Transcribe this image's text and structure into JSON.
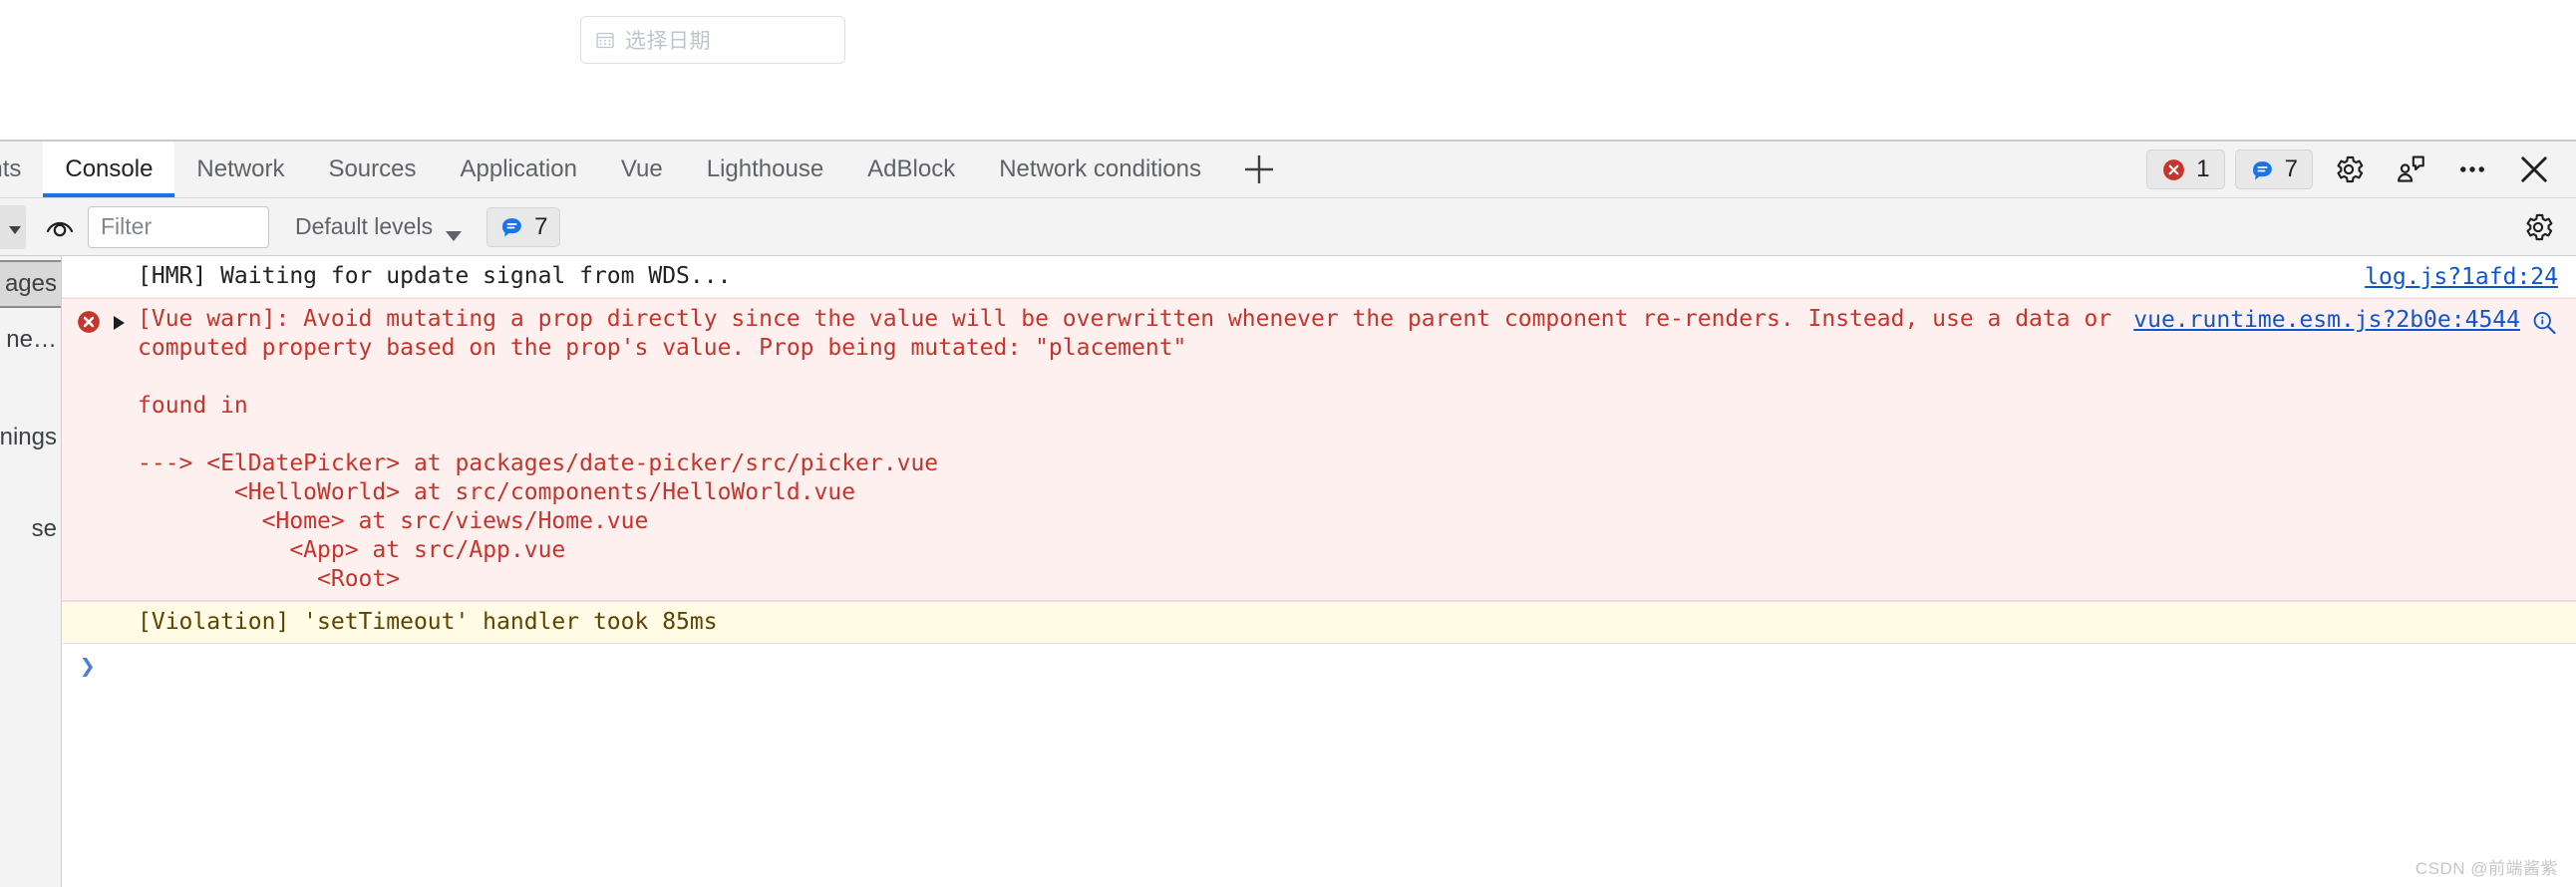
{
  "page": {
    "datepicker": {
      "placeholder": "选择日期",
      "icon": "calendar-icon",
      "value": ""
    }
  },
  "devtools": {
    "tabs": [
      {
        "label": "ments",
        "active": false,
        "clipped": true
      },
      {
        "label": "Console",
        "active": true,
        "clipped": false
      },
      {
        "label": "Network",
        "active": false,
        "clipped": false
      },
      {
        "label": "Sources",
        "active": false,
        "clipped": false
      },
      {
        "label": "Application",
        "active": false,
        "clipped": false
      },
      {
        "label": "Vue",
        "active": false,
        "clipped": false
      },
      {
        "label": "Lighthouse",
        "active": false,
        "clipped": false
      },
      {
        "label": "AdBlock",
        "active": false,
        "clipped": false
      },
      {
        "label": "Network conditions",
        "active": false,
        "clipped": false
      }
    ],
    "add_tab_label": "+",
    "status": {
      "error_count": "1",
      "info_count": "7",
      "error_color": "#c5352b",
      "info_color": "#1a73e8"
    },
    "toolbar_icons": [
      {
        "name": "settings-gear-icon"
      },
      {
        "name": "feedback-icon"
      },
      {
        "name": "more-options-icon"
      },
      {
        "name": "close-devtools-icon"
      }
    ],
    "filterbar": {
      "eye_icon": "live-expression-eye-icon",
      "filter_placeholder": "Filter",
      "filter_value": "",
      "levels_label": "Default levels",
      "levels_count": "7",
      "settings_icon": "console-settings-gear-icon"
    },
    "sidebar": {
      "items": [
        {
          "label": "ages",
          "selected": true
        },
        {
          "label": "ne…",
          "selected": false
        },
        {
          "label": "nings",
          "selected": false
        },
        {
          "label": "se",
          "selected": false
        }
      ]
    },
    "console": {
      "messages": [
        {
          "level": "info",
          "text": "[HMR] Waiting for update signal from WDS...",
          "source": "log.js?1afd:24",
          "has_expander": false,
          "has_error_badge": false,
          "has_magnifier": false
        },
        {
          "level": "error",
          "text": "[Vue warn]: Avoid mutating a prop directly since the value will be overwritten whenever the parent component re-renders. Instead, use a data or computed property based on the prop's value. Prop being mutated: \"placement\"\n\nfound in\n\n---> <ElDatePicker> at packages/date-picker/src/picker.vue\n       <HelloWorld> at src/components/HelloWorld.vue\n         <Home> at src/views/Home.vue\n           <App> at src/App.vue\n             <Root>",
          "source": "vue.runtime.esm.js?2b0e:4544",
          "has_expander": true,
          "has_error_badge": true,
          "has_magnifier": true
        },
        {
          "level": "warning",
          "text": "[Violation] 'setTimeout' handler took 85ms",
          "source": "",
          "has_expander": false,
          "has_error_badge": false,
          "has_magnifier": false
        }
      ],
      "prompt_caret": "❯"
    }
  },
  "watermark": "CSDN @前端酱紫"
}
